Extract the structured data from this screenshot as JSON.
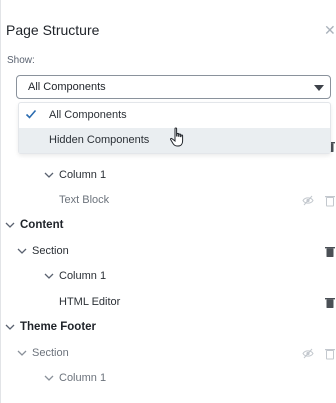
{
  "panel": {
    "title": "Page Structure",
    "close_icon": "close-icon"
  },
  "filter": {
    "show_label": "Show:",
    "selected": "All Components",
    "options": [
      {
        "label": "All Components",
        "checked": true
      },
      {
        "label": "Hidden Components",
        "checked": false
      }
    ]
  },
  "tree": [
    {
      "label": "Column 1",
      "level": 2,
      "expanded": true
    },
    {
      "label": "Text Block",
      "level": 3,
      "hidden": true,
      "icons": [
        "eye-off-icon",
        "trash-icon"
      ]
    },
    {
      "label": "Content",
      "level": 0,
      "expanded": true
    },
    {
      "label": "Section",
      "level": 1,
      "expanded": true,
      "icons": [
        "trash-icon"
      ]
    },
    {
      "label": "Column 1",
      "level": 2,
      "expanded": true
    },
    {
      "label": "HTML Editor",
      "level": 3,
      "icons": [
        "trash-icon"
      ]
    },
    {
      "label": "Theme Footer",
      "level": 0,
      "expanded": true
    },
    {
      "label": "Section",
      "level": 1,
      "expanded": true,
      "hidden": true,
      "icons": [
        "eye-off-icon",
        "trash-icon"
      ]
    },
    {
      "label": "Column 1",
      "level": 2,
      "expanded": true,
      "hidden": true
    }
  ],
  "colors": {
    "accent": "#2b6cb0",
    "muted_icon": "#c3c8ce",
    "dark_icon": "#4a4f55"
  }
}
